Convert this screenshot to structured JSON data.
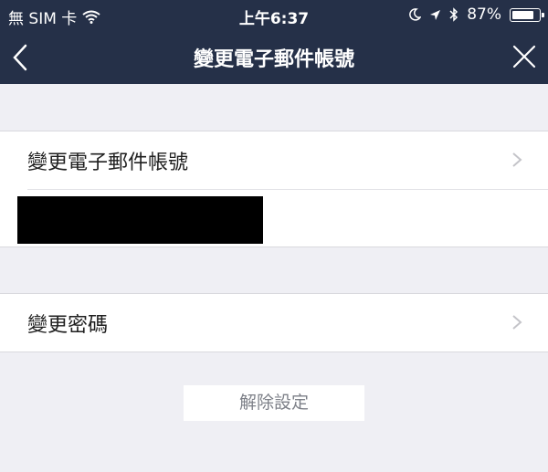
{
  "status_bar": {
    "carrier": "無 SIM 卡",
    "time": "上午6:37",
    "battery_percent": "87%",
    "battery_level": 0.87
  },
  "navbar": {
    "title": "變更電子郵件帳號",
    "back_icon": "chevron-left-icon",
    "close_icon": "close-icon"
  },
  "email_section": {
    "label": "變更電子郵件帳號",
    "chevron_icon": "chevron-right-icon"
  },
  "password_section": {
    "label": "變更密碼",
    "chevron_icon": "chevron-right-icon"
  },
  "unset_button": {
    "label": "解除設定"
  },
  "colors": {
    "navbar_bg": "#253048",
    "page_bg": "#efeff4",
    "button_text": "#7d8088"
  }
}
